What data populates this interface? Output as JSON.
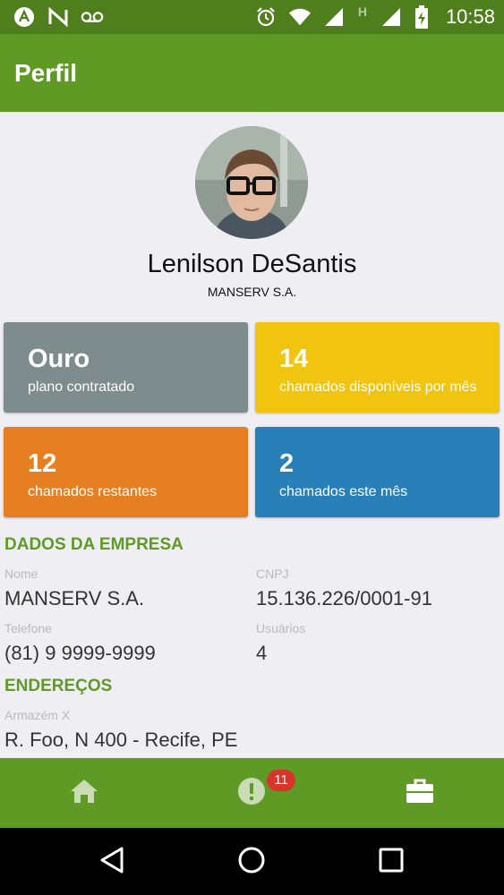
{
  "status_bar": {
    "time": "10:58",
    "left_icons": [
      "app-a-icon",
      "app-n-icon",
      "voicemail-icon"
    ],
    "right_icons": [
      "alarm-icon",
      "wifi-icon",
      "signal-icon",
      "h-network-icon",
      "signal-icon",
      "battery-charging-icon"
    ],
    "network_label": "H"
  },
  "app_bar": {
    "title": "Perfil"
  },
  "profile": {
    "name": "Lenilson DeSantis",
    "company": "MANSERV S.A."
  },
  "stats": [
    {
      "value": "Ouro",
      "label": "plano contratado",
      "color": "#7f8c8d"
    },
    {
      "value": "14",
      "label": "chamados disponíveis por mês",
      "color": "#f1c40f"
    },
    {
      "value": "12",
      "label": "chamados restantes",
      "color": "#e67e22"
    },
    {
      "value": "2",
      "label": "chamados este mês",
      "color": "#2980b9"
    }
  ],
  "company_section": {
    "title": "DADOS DA EMPRESA",
    "fields": [
      {
        "label": "Nome",
        "value": "MANSERV S.A."
      },
      {
        "label": "CNPJ",
        "value": "15.136.226/0001-91"
      },
      {
        "label": "Telefone",
        "value": "(81) 9 9999-9999"
      },
      {
        "label": "Usuários",
        "value": "4"
      }
    ]
  },
  "addresses_section": {
    "title": "ENDEREÇOS",
    "items": [
      {
        "label": "Armazém X",
        "value": "R. Foo, N 400 - Recife, PE"
      }
    ]
  },
  "bottom_nav": {
    "items": [
      "home-icon",
      "alert-icon",
      "briefcase-icon"
    ],
    "badge_count": "11",
    "active": "briefcase-icon"
  },
  "system_nav": [
    "back-icon",
    "home-circle-icon",
    "recents-icon"
  ],
  "colors": {
    "primary": "#5f9b24",
    "status_bar": "#4e7f1c",
    "badge": "#d9342b"
  }
}
